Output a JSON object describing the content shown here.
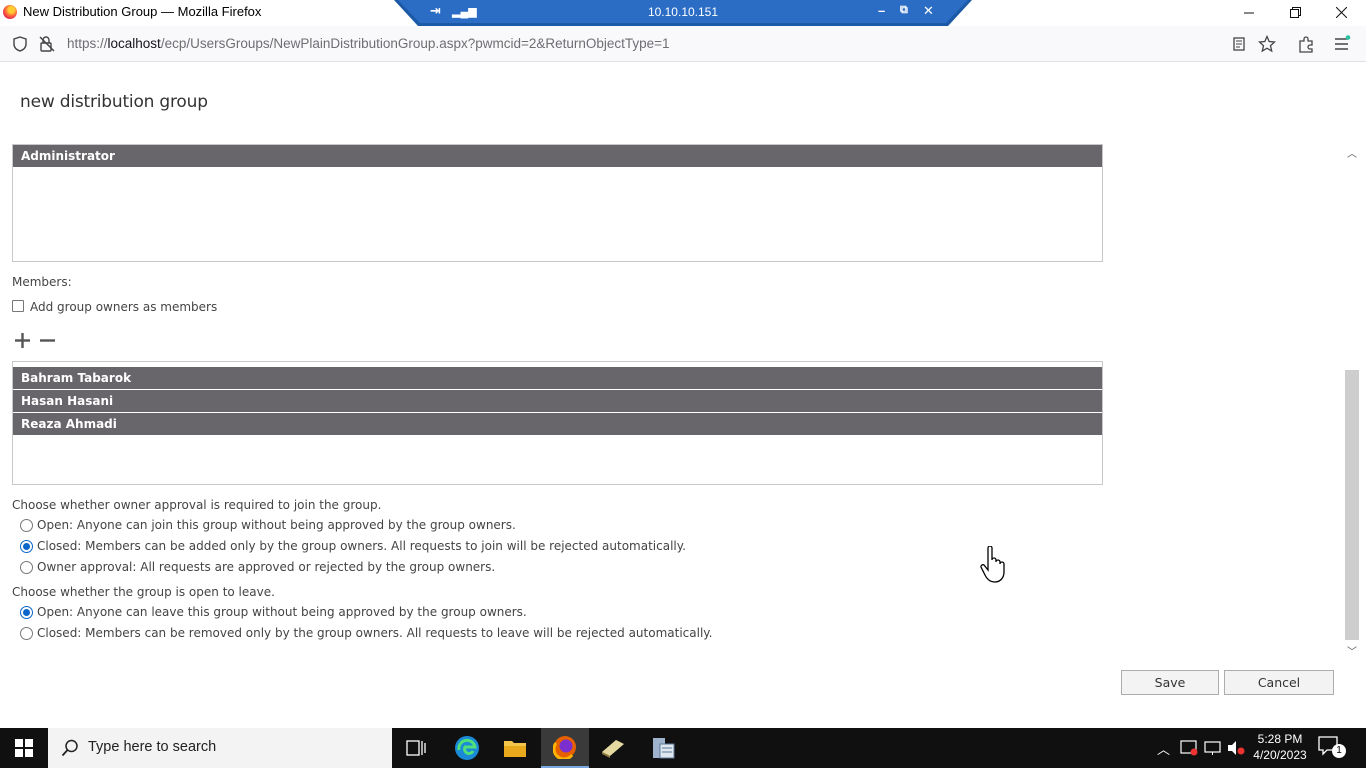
{
  "window": {
    "title": "New Distribution Group — Mozilla Firefox",
    "rdp_host": "10.10.10.151"
  },
  "browser": {
    "url_prefix": "https://",
    "url_host": "localhost",
    "url_path": "/ecp/UsersGroups/NewPlainDistributionGroup.aspx?pwmcid=2&ReturnObjectType=1"
  },
  "page": {
    "title": "new distribution group",
    "owners": [
      "Administrator"
    ],
    "members_label": "Members:",
    "add_owners_label": "Add group owners as members",
    "add_owners_checked": false,
    "members": [
      "Bahram Tabarok",
      "Hasan Hasani",
      "Reaza Ahmadi"
    ],
    "join_question": "Choose whether owner approval is required to join the group.",
    "join_options": [
      {
        "label": "Open: Anyone can join this group without being approved by the group owners.",
        "selected": false
      },
      {
        "label": "Closed: Members can be added only by the group owners. All requests to join will be rejected automatically.",
        "selected": true
      },
      {
        "label": "Owner approval: All requests are approved or rejected by the group owners.",
        "selected": false
      }
    ],
    "leave_question": "Choose whether the group is open to leave.",
    "leave_options": [
      {
        "label": "Open: Anyone can leave this group without being approved by the group owners.",
        "selected": true
      },
      {
        "label": "Closed: Members can be removed only by the group owners. All requests to leave will be rejected automatically.",
        "selected": false
      }
    ],
    "save_label": "Save",
    "cancel_label": "Cancel"
  },
  "taskbar": {
    "search_placeholder": "Type here to search",
    "time": "5:28 PM",
    "date": "4/20/2023",
    "notification_count": "1"
  }
}
